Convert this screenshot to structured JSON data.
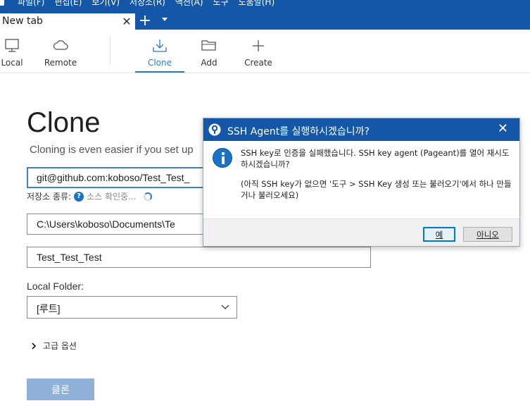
{
  "menubar": {
    "items": [
      "파일(F)",
      "편집(E)",
      "보기(V)",
      "저장소(R)",
      "액션(A)",
      "도구",
      "도움말(H)"
    ]
  },
  "tabbar": {
    "tab_title": "New tab",
    "close_glyph": "✕",
    "new_tab_glyph": "+"
  },
  "toolbar": {
    "local": "Local",
    "remote": "Remote",
    "clone": "Clone",
    "add": "Add",
    "create": "Create",
    "active": "clone",
    "accent": "#2b79c7"
  },
  "main": {
    "title": "Clone",
    "subtitle": "Cloning is even easier if you set up",
    "source_url": "git@github.com:koboso/Test_Test_",
    "repo_type_label": "저장소 종류:",
    "repo_type_status": "소스 확인중...",
    "destination_path": "C:\\Users\\koboso\\Documents\\Te",
    "name": "Test_Test_Test",
    "local_folder_label": "Local Folder:",
    "local_folder_value": "[루트]",
    "advanced_label": "고급 옵션",
    "clone_button": "클론"
  },
  "dialog": {
    "title": "SSH Agent를 실행하시겠습니까?",
    "close_glyph": "✕",
    "message_1": "SSH key로 인증을 실패했습니다. SSH key agent (Pageant)를 열어 재시도하시겠습니까?",
    "message_2": "(아직 SSH key가 없으면 '도구 > SSH Key 생성 또는 불러오기'에서 하나 만들거나 불러오세요)",
    "yes": "예",
    "no": "아니오"
  },
  "colors": {
    "titlebar": "#1457a8",
    "clone_button_disabled": "#8fb0d8",
    "info": "#1a73c8"
  }
}
